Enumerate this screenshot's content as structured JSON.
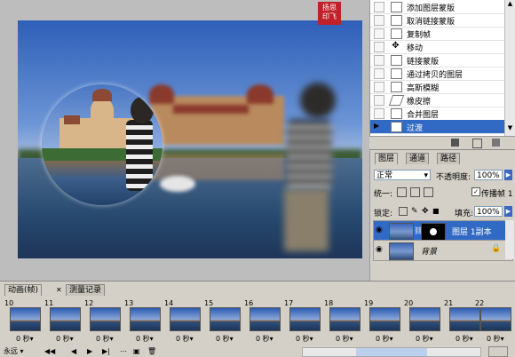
{
  "watermark": {
    "line1": "扬思",
    "line2": "印飞"
  },
  "history": {
    "items": [
      {
        "label": "添加图层蒙版",
        "icon": "doc-icon",
        "selected": false
      },
      {
        "label": "取消链接蒙版",
        "icon": "doc-icon",
        "selected": false
      },
      {
        "label": "复制帧",
        "icon": "doc-icon",
        "selected": false
      },
      {
        "label": "移动",
        "icon": "move-icon",
        "selected": false
      },
      {
        "label": "链接蒙版",
        "icon": "doc-icon",
        "selected": false
      },
      {
        "label": "通过拷贝的图层",
        "icon": "doc-icon",
        "selected": false
      },
      {
        "label": "高斯模糊",
        "icon": "doc-icon",
        "selected": false
      },
      {
        "label": "橡皮擦",
        "icon": "eraser-icon",
        "selected": false
      },
      {
        "label": "合并图层",
        "icon": "doc-icon",
        "selected": false
      },
      {
        "label": "过渡",
        "icon": "doc-icon",
        "selected": true
      }
    ]
  },
  "layers": {
    "tabs": [
      "图层",
      "通道",
      "路径"
    ],
    "blend_mode": "正常",
    "opacity_label": "不透明度:",
    "opacity_value": "100%",
    "unify_label": "统一:",
    "propagate_label": "传播帧 1",
    "lock_label": "锁定:",
    "fill_label": "填充:",
    "fill_value": "100%",
    "rows": [
      {
        "name": "图层 1副本",
        "selected": true
      },
      {
        "name": "背景",
        "selected": false
      }
    ]
  },
  "animation": {
    "tabs": [
      "动画(帧)",
      "测量记录"
    ],
    "frames": [
      {
        "num": "10",
        "delay": "0 秒▾"
      },
      {
        "num": "11",
        "delay": "0 秒▾"
      },
      {
        "num": "12",
        "delay": "0 秒▾"
      },
      {
        "num": "13",
        "delay": "0 秒▾"
      },
      {
        "num": "14",
        "delay": "0 秒▾"
      },
      {
        "num": "15",
        "delay": "0 秒▾"
      },
      {
        "num": "16",
        "delay": "0 秒▾"
      },
      {
        "num": "17",
        "delay": "0 秒▾"
      },
      {
        "num": "18",
        "delay": "0 秒▾"
      },
      {
        "num": "19",
        "delay": "0 秒▾"
      },
      {
        "num": "20",
        "delay": "0 秒▾"
      },
      {
        "num": "21",
        "delay": "0 秒▾"
      },
      {
        "num": "22",
        "delay": "0 秒▾"
      }
    ],
    "loop_option": "永远"
  }
}
